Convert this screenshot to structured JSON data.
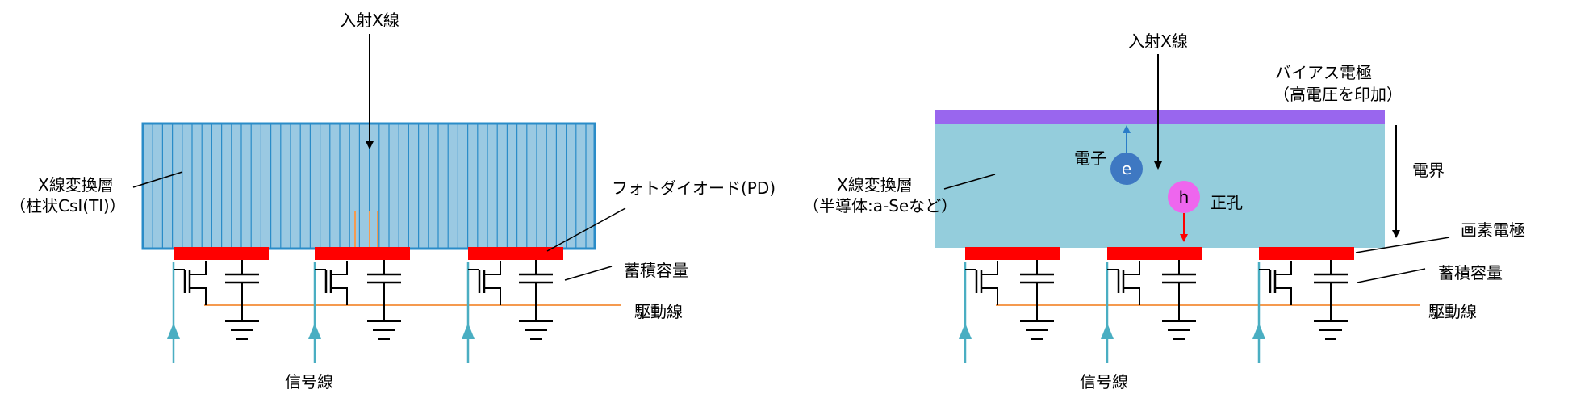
{
  "left": {
    "incident_label": "入射X線",
    "conversion_layer_label": "X線変換層",
    "conversion_layer_sub": "（柱状CsI(Tl)）",
    "photodiode_label": "フォトダイオード(PD)",
    "capacitor_label": "蓄積容量",
    "drive_line_label": "駆動線",
    "signal_line_label": "信号線"
  },
  "right": {
    "incident_label": "入射X線",
    "bias_label": "バイアス電極",
    "bias_sub": "（高電圧を印加）",
    "conversion_layer_label": "X線変換層",
    "conversion_layer_sub": "（半導体:a-Seなど）",
    "electron_label": "電子",
    "electron_symbol": "e",
    "hole_label": "正孔",
    "hole_symbol": "h",
    "field_label": "電界",
    "pixel_electrode_label": "画素電極",
    "capacitor_label": "蓄積容量",
    "drive_line_label": "駆動線",
    "signal_line_label": "信号線"
  },
  "colors": {
    "csi_fill": "#9ac9e2",
    "csi_stroke": "#2a8cc8",
    "semiconductor_fill": "#94cddc",
    "bias_electrode": "#9966ee",
    "electrode_red": "#ff0000",
    "drive_line": "#f59a4f",
    "signal_line": "#4aaec2",
    "electron": "#3e78c2",
    "hole": "#ee66ee"
  }
}
